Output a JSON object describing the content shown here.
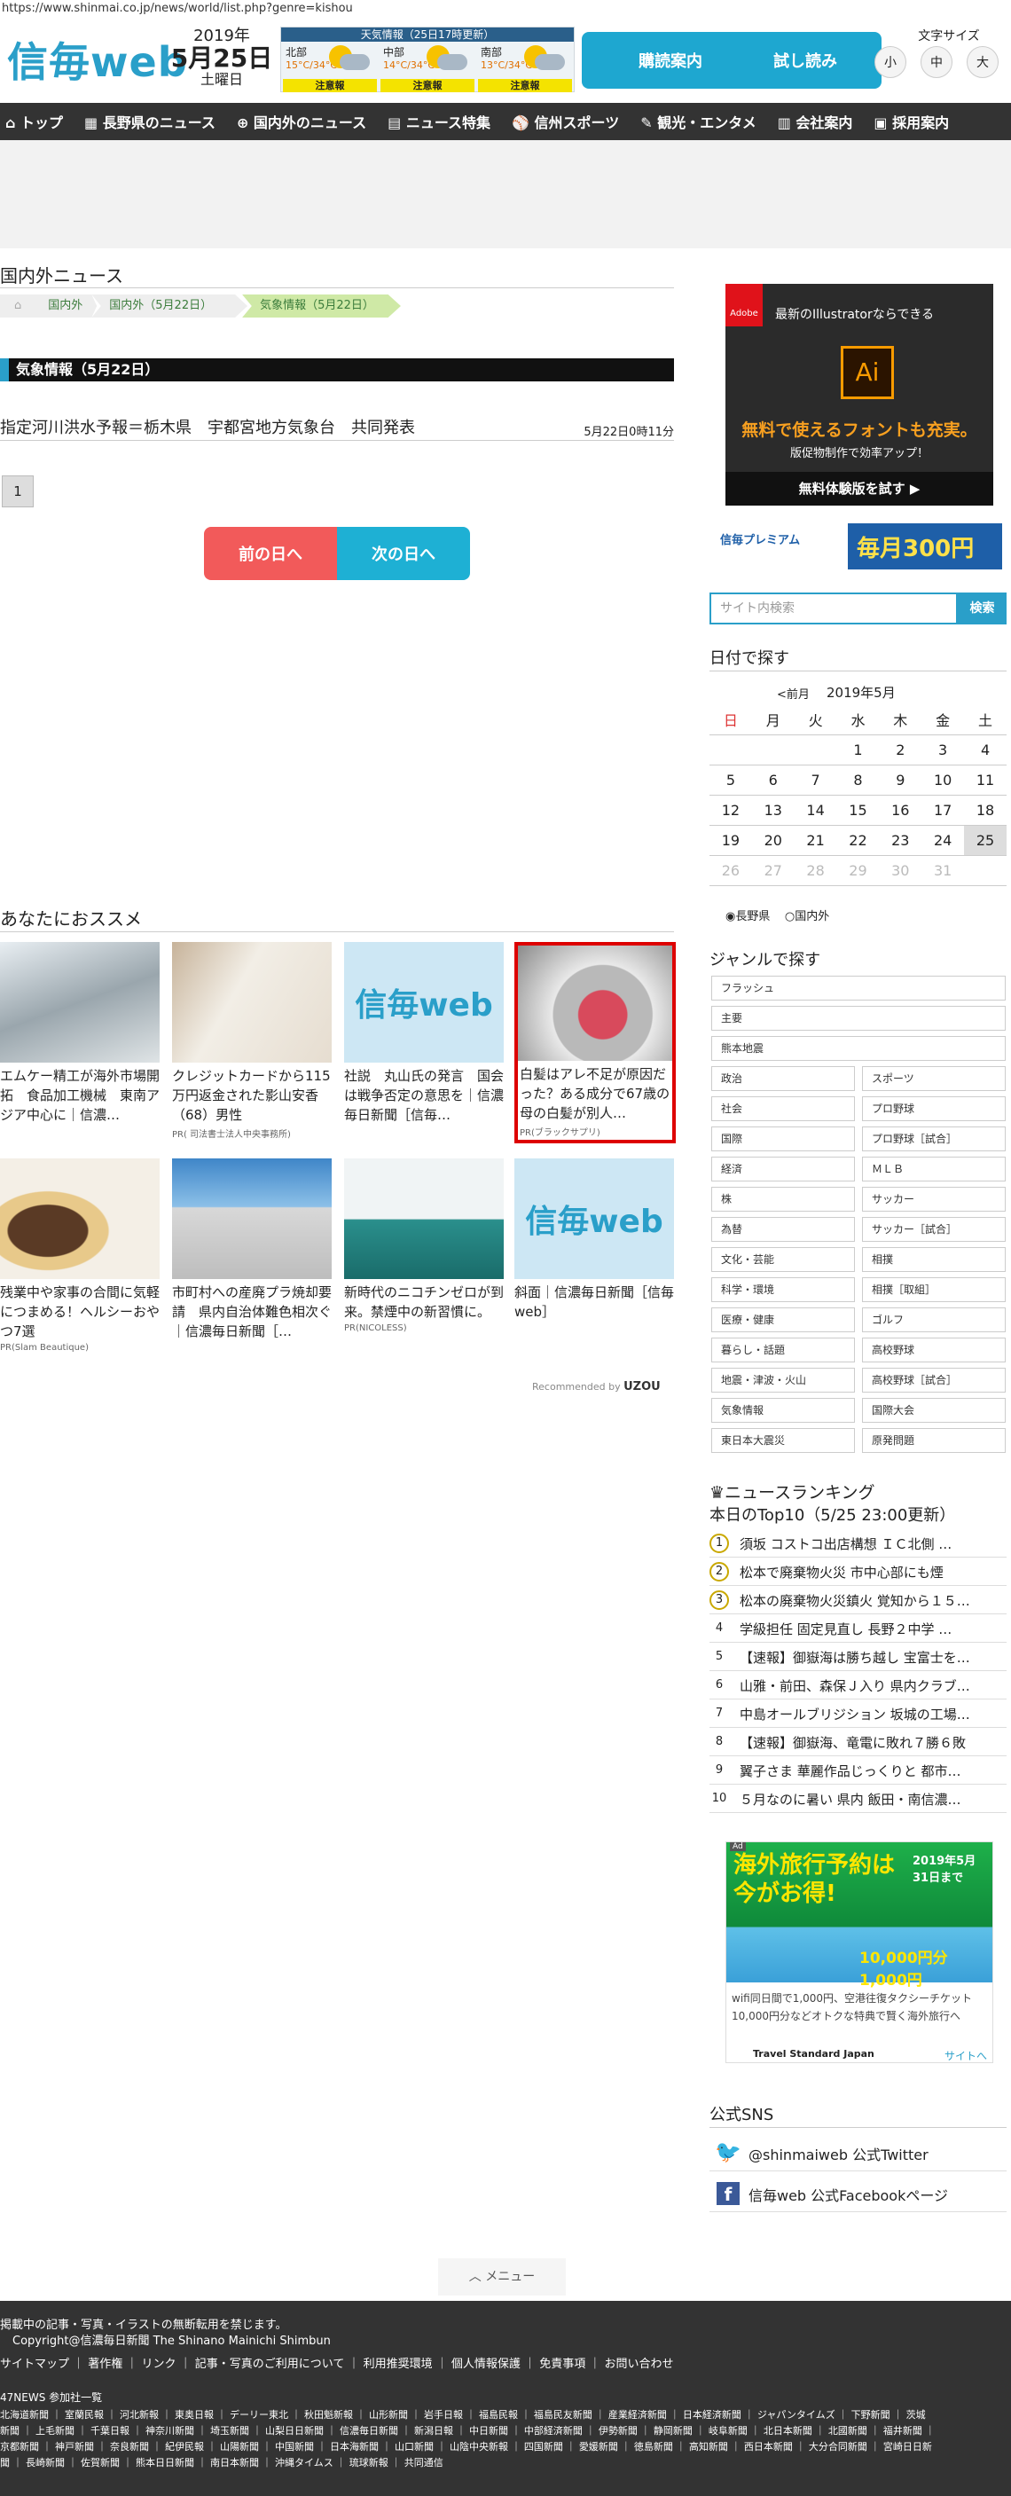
{
  "url": "https://www.shinmai.co.jp/news/world/list.php?genre=kishou",
  "header": {
    "logo": "信毎web",
    "year": "2019年",
    "date": "5月25日",
    "weekday": "土曜日",
    "weather": {
      "title": "天気情報（25日17時更新）",
      "regions": [
        {
          "name": "北部",
          "temp": "15°C/34°C",
          "warn": "注意報"
        },
        {
          "name": "中部",
          "temp": "14°C/34°C",
          "warn": "注意報"
        },
        {
          "name": "南部",
          "temp": "13°C/34°C",
          "warn": "注意報"
        }
      ]
    },
    "subscribe": "購読案内",
    "trial": "試し読み",
    "fontsize_label": "文字サイズ",
    "fontsizes": [
      "小",
      "中",
      "大"
    ]
  },
  "nav": [
    "トップ",
    "長野県のニュース",
    "国内外のニュース",
    "ニュース特集",
    "信州スポーツ",
    "観光・エンタメ",
    "会社案内",
    "採用案内"
  ],
  "main": {
    "title": "国内外ニュース",
    "breadcrumb": [
      "国内外",
      "国内外（5月22日）",
      "気象情報（5月22日）"
    ],
    "section": "気象情報（5月22日）",
    "article": {
      "title": "指定河川洪水予報＝栃木県　宇都宮地方気象台　共同発表",
      "date": "5月22日0時11分"
    },
    "page": "1",
    "prev": "前の日へ",
    "next": "次の日へ"
  },
  "recommend": {
    "title": "あなたにおススメ",
    "by": "Recommended by",
    "items": [
      {
        "title": "エムケー精工が海外市場開拓　食品加工機械　東南アジア中心に｜信濃…",
        "pr": ""
      },
      {
        "title": "クレジットカードから115万円返金された影山安香（68）男性",
        "pr": "PR( 司法書士法人中央事務所)"
      },
      {
        "title": "社説　丸山氏の発言　国会は戦争否定の意思を｜信濃毎日新聞［信毎…",
        "pr": ""
      },
      {
        "title": "白髪はアレ不足が原因だった？ある成分で67歳の母の白髪が別人…",
        "pr": "PR(ブラックサプリ)"
      },
      {
        "title": "残業中や家事の合間に気軽につまめる！ヘルシーおやつ7選",
        "pr": "PR(Slam Beautique)"
      },
      {
        "title": "市町村への産廃プラ焼却要請　県内自治体難色相次ぐ｜信濃毎日新聞［…",
        "pr": ""
      },
      {
        "title": "新時代のニコチンゼロが到来。禁煙中の新習慣に。",
        "pr": "PR(NICOLESS)"
      },
      {
        "title": "斜面｜信濃毎日新聞［信毎web］",
        "pr": ""
      }
    ]
  },
  "sidebar": {
    "ad1": {
      "brand": "Adobe",
      "line1": "最新のIllustratorならできる",
      "line2": "無料で使えるフォントも充実。",
      "line3": "版促物制作で効率アップ！",
      "cta": "無料体験版を試す ▶"
    },
    "ad2": {
      "text": "毎月300円",
      "sub": "信毎プレミアム"
    },
    "search_placeholder": "サイト内検索",
    "search_btn": "検索",
    "calendar": {
      "title": "日付で探す",
      "prev": "<前月",
      "month": "2019年5月",
      "weekdays": [
        "日",
        "月",
        "火",
        "水",
        "木",
        "金",
        "土"
      ],
      "rows": [
        [
          "",
          "",
          "",
          "1",
          "2",
          "3",
          "4"
        ],
        [
          "5",
          "6",
          "7",
          "8",
          "9",
          "10",
          "11"
        ],
        [
          "12",
          "13",
          "14",
          "15",
          "16",
          "17",
          "18"
        ],
        [
          "19",
          "20",
          "21",
          "22",
          "23",
          "24",
          "25"
        ],
        [
          "26",
          "27",
          "28",
          "29",
          "30",
          "31",
          ""
        ]
      ],
      "radio": [
        "長野県",
        "国内外"
      ]
    },
    "genre": {
      "title": "ジャンルで探す",
      "full": [
        "フラッシュ",
        "主要",
        "熊本地震"
      ],
      "pairs": [
        [
          "政治",
          "スポーツ"
        ],
        [
          "社会",
          "プロ野球"
        ],
        [
          "国際",
          "プロ野球［試合］"
        ],
        [
          "経済",
          "ＭＬＢ"
        ],
        [
          "株",
          "サッカー"
        ],
        [
          "為替",
          "サッカー［試合］"
        ],
        [
          "文化・芸能",
          "相撲"
        ],
        [
          "科学・環境",
          "相撲［取組］"
        ],
        [
          "医療・健康",
          "ゴルフ"
        ],
        [
          "暮らし・話題",
          "高校野球"
        ],
        [
          "地震・津波・火山",
          "高校野球［試合］"
        ],
        [
          "気象情報",
          "国際大会"
        ],
        [
          "東日本大震災",
          "原発問題"
        ]
      ]
    },
    "ranking": {
      "title": "ニュースランキング",
      "sub": "本日のTop10（5/25 23:00更新）",
      "items": [
        "須坂 コストコ出店構想 ＩＣ北側 …",
        "松本で廃棄物火災 市中心部にも煙",
        "松本の廃棄物火災鎮火 覚知から１５…",
        "学級担任 固定見直し 長野２中学 …",
        "【速報】御嶽海は勝ち越し 宝富士を…",
        "山雅・前田、森保Ｊ入り 県内クラブ…",
        "中島オールブリジション 坂城の工場…",
        "【速報】御嶽海、竜電に敗れ７勝６敗",
        "翼子さま 華麗作品じっくりと 都市…",
        "５月なのに暑い 県内 飯田・南信濃…"
      ]
    },
    "ad3": {
      "headline": "海外旅行予約は今がお得!",
      "date": "2019年5月31日まで",
      "price": "10,000円分 1,000円",
      "body": "wifi同日間で1,000円、空港往復タクシーチケット10,000円分などオトクな特典で賢く海外旅行へ",
      "brand": "Travel Standard Japan",
      "link": "サイトへ"
    },
    "sns": {
      "title": "公式SNS",
      "twitter": "@shinmaiweb 公式Twitter",
      "facebook": "信毎web 公式Facebookページ"
    }
  },
  "menu": "メニュー",
  "footer": {
    "notice": "掲載中の記事・写真・イラストの無断転用を禁じます。",
    "copy": "Copyright@信濃毎日新聞 The Shinano Mainichi Shimbun",
    "links": "サイトマップ ｜ 著作権 ｜ リンク ｜ 記事・写真のご利用について ｜ 利用推奨環境 ｜ 個人情報保護 ｜ 免責事項 ｜ お問い合わせ",
    "members_title": "47NEWS 参加社一覧",
    "members1": "北海道新聞 ｜ 室蘭民報 ｜ 河北新報 ｜ 東奥日報 ｜ デーリー東北 ｜ 秋田魁新報 ｜ 山形新聞 ｜ 岩手日報 ｜ 福島民報 ｜ 福島民友新聞 ｜ 産業経済新聞 ｜ 日本経済新聞 ｜ ジャパンタイムズ ｜ 下野新聞 ｜ 茨城",
    "members2": "新聞 ｜ 上毛新聞 ｜ 千葉日報 ｜ 神奈川新聞 ｜ 埼玉新聞 ｜ 山梨日日新聞 ｜ 信濃毎日新聞 ｜ 新潟日報 ｜ 中日新聞 ｜ 中部経済新聞 ｜ 伊勢新聞 ｜ 静岡新聞 ｜ 岐阜新聞 ｜ 北日本新聞 ｜ 北國新聞 ｜ 福井新聞 ｜",
    "members3": "京都新聞 ｜ 神戸新聞 ｜ 奈良新聞 ｜ 紀伊民報 ｜ 山陽新聞 ｜ 中国新聞 ｜ 日本海新聞 ｜ 山口新聞 ｜ 山陰中央新報 ｜ 四国新聞 ｜ 愛媛新聞 ｜ 徳島新聞 ｜ 高知新聞 ｜ 西日本新聞 ｜ 大分合同新聞 ｜ 宮崎日日新",
    "members4": "聞 ｜ 長崎新聞 ｜ 佐賀新聞 ｜ 熊本日日新聞 ｜ 南日本新聞 ｜ 沖縄タイムス ｜ 琉球新報 ｜ 共同通信"
  },
  "colors": {
    "brand": "#2a9fc9",
    "nav": "#333333",
    "prev": "#f25a5a",
    "next": "#1eb0d4"
  }
}
